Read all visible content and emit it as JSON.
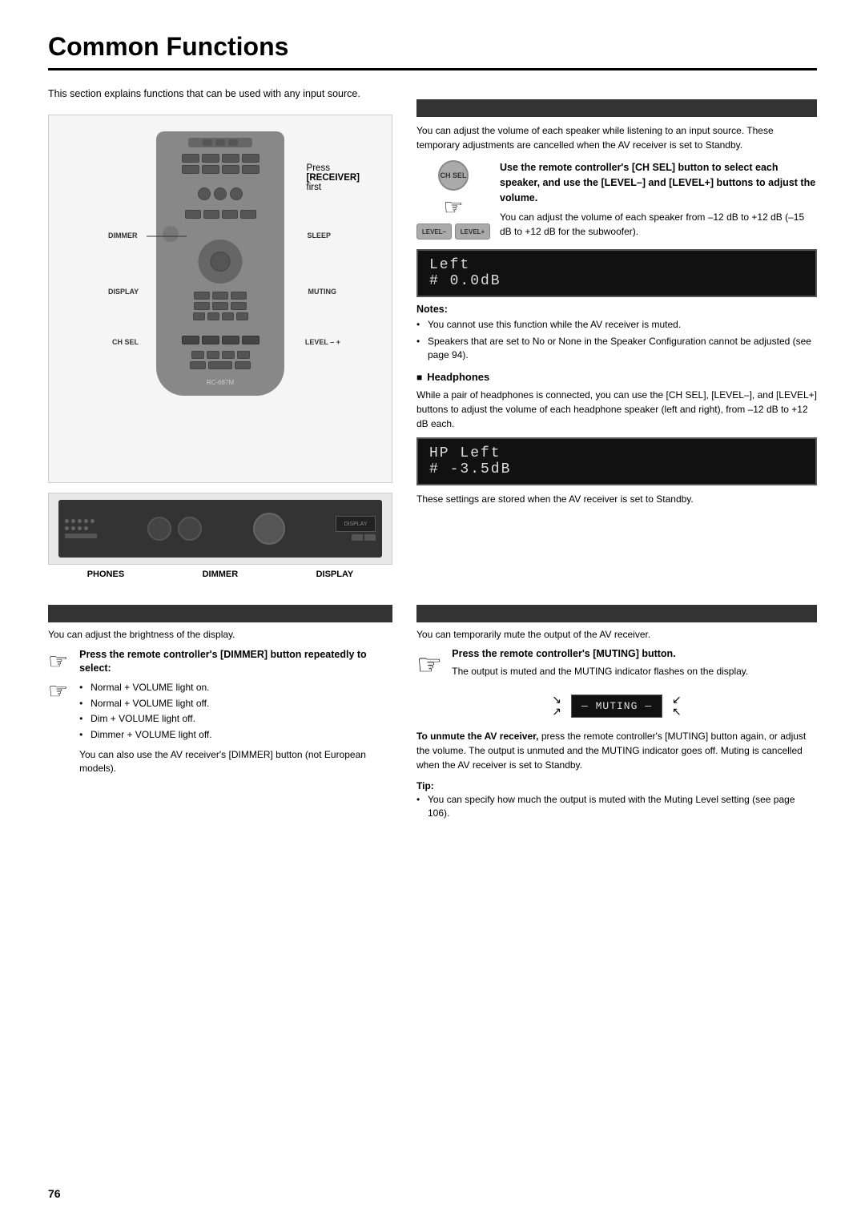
{
  "page": {
    "title": "Common Functions",
    "number": "76"
  },
  "intro": {
    "text": "This section explains functions that can be used with any input source."
  },
  "left_section": {
    "remote_labels": {
      "dimmer": "DIMMER",
      "display": "DISPLAY",
      "ch_sel": "CH SEL",
      "sleep": "SLEEP",
      "muting": "MUTING",
      "level": "LEVEL – +"
    },
    "press_label": {
      "line1": "Press",
      "line2": "[RECEIVER]",
      "line3": "first"
    },
    "rc_model": "RC-687M",
    "panel_labels": {
      "phones": "PHONES",
      "dimmer": "DIMMER",
      "display": "DISPLAY"
    }
  },
  "right_top_section": {
    "header": "",
    "intro_text": "You can adjust the volume of each speaker while listening to an input source. These temporary adjustments are cancelled when the AV receiver is set to Standby.",
    "instruction": {
      "bold_text": "Use the remote controller's [CH SEL] button to select each speaker, and use the [LEVEL–] and [LEVEL+] buttons to adjust the volume.",
      "description": "You can adjust the volume of each speaker from –12 dB to +12 dB (–15 dB to +12 dB for the subwoofer)."
    },
    "display_line1": "Left",
    "display_line2": "#  0.0dB",
    "notes_title": "Notes:",
    "notes": [
      "You cannot use this function while the AV receiver is muted.",
      "Speakers that are set to No or None in the Speaker Configuration cannot be adjusted (see page 94)."
    ],
    "headphones": {
      "title": "Headphones",
      "text": "While a pair of headphones is connected, you can use the [CH SEL], [LEVEL–], and [LEVEL+] buttons to adjust the volume of each headphone speaker (left and right), from –12 dB to +12 dB each.",
      "display_line1": "HP Left",
      "display_line2": "#  -3.5dB",
      "footer_text": "These settings are stored when the AV receiver is set to Standby."
    }
  },
  "bottom_left_section": {
    "header": "",
    "intro_text": "You can adjust the brightness of the display.",
    "instruction_title": "Press the remote controller's [DIMMER] button repeatedly to select:",
    "bullets": [
      "Normal + VOLUME light on.",
      "Normal + VOLUME light off.",
      "Dim + VOLUME light off.",
      "Dimmer + VOLUME light off."
    ],
    "also_text": "You can also use the AV receiver's [DIMMER] button (not European models)."
  },
  "bottom_right_section": {
    "header": "",
    "intro_text": "You can temporarily mute the output of the AV receiver.",
    "instruction_title": "Press the remote controller's [MUTING] button.",
    "muting_desc": "The output is muted and the MUTING indicator flashes on the display.",
    "muting_display": "— MUTING —",
    "unmute_text": "To unmute the AV receiver, press the remote controller's [MUTING] button again, or adjust the volume. The output is unmuted and the MUTING indicator goes off. Muting is cancelled when the AV receiver is set to Standby.",
    "tip_title": "Tip:",
    "tip_text": "You can specify how much the output is muted with the Muting Level setting (see page 106)."
  }
}
